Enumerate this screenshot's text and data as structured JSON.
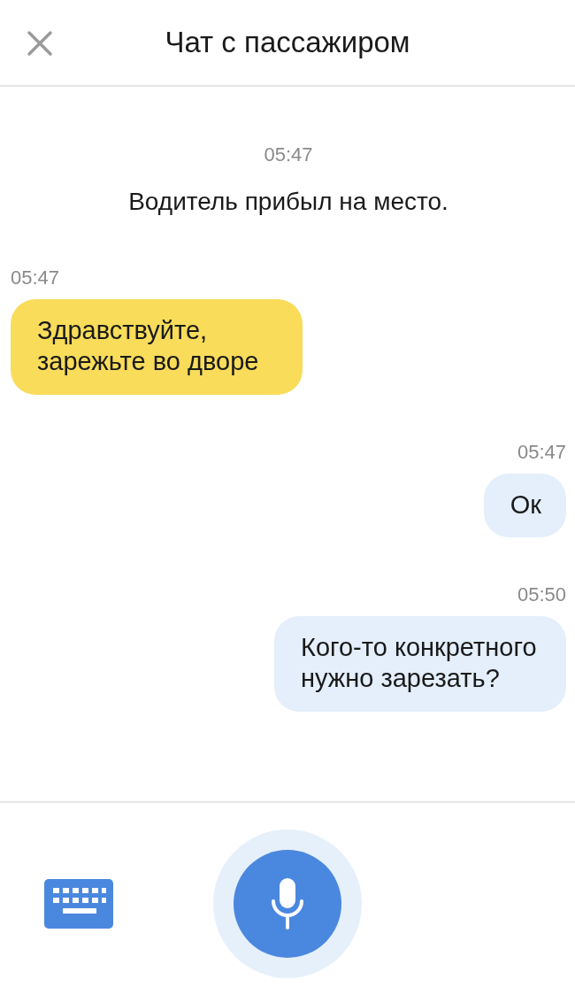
{
  "header": {
    "title": "Чат с пассажиром"
  },
  "messages": [
    {
      "kind": "system",
      "time": "05:47",
      "text": "Водитель прибыл на место."
    },
    {
      "kind": "incoming",
      "time": "05:47",
      "text": "Здравствуйте, зарежьте во дворе"
    },
    {
      "kind": "outgoing",
      "time": "05:47",
      "text": "Ок"
    },
    {
      "kind": "outgoing",
      "time": "05:50",
      "text": "Кого-то конкретного нужно зарезать?"
    }
  ]
}
